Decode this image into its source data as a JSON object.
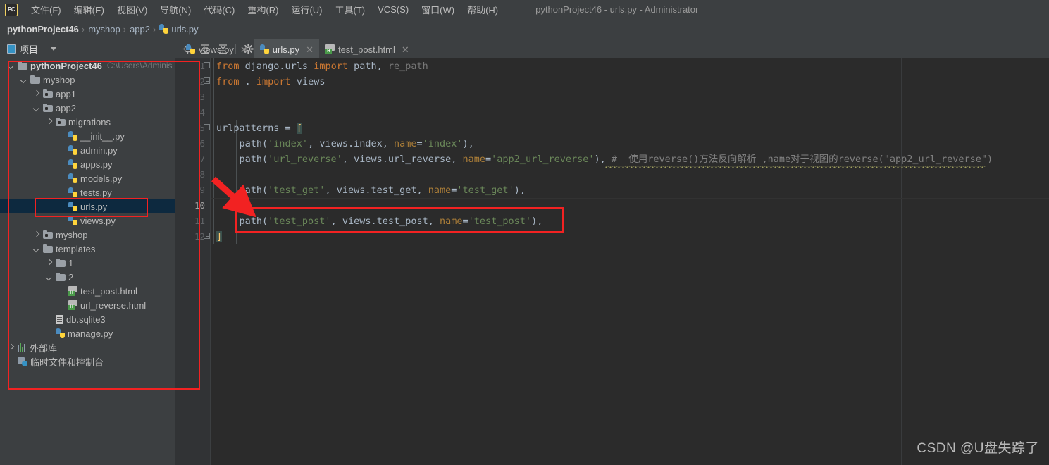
{
  "window": {
    "title": "pythonProject46 - urls.py - Administrator",
    "logo_text": "PC"
  },
  "menubar": {
    "items": [
      {
        "label": "文件(F)",
        "name": "menu-file"
      },
      {
        "label": "编辑(E)",
        "name": "menu-edit"
      },
      {
        "label": "视图(V)",
        "name": "menu-view"
      },
      {
        "label": "导航(N)",
        "name": "menu-navigate"
      },
      {
        "label": "代码(C)",
        "name": "menu-code"
      },
      {
        "label": "重构(R)",
        "name": "menu-refactor"
      },
      {
        "label": "运行(U)",
        "name": "menu-run"
      },
      {
        "label": "工具(T)",
        "name": "menu-tools"
      },
      {
        "label": "VCS(S)",
        "name": "menu-vcs"
      },
      {
        "label": "窗口(W)",
        "name": "menu-window"
      },
      {
        "label": "帮助(H)",
        "name": "menu-help"
      }
    ]
  },
  "breadcrumb": {
    "items": [
      "pythonProject46",
      "myshop",
      "app2",
      "urls.py"
    ],
    "separator": "›"
  },
  "toolwindow": {
    "title": "项目",
    "buttons": [
      {
        "name": "select-opened-file-icon",
        "title": "locate"
      },
      {
        "name": "expand-all-icon",
        "title": "expand all"
      },
      {
        "name": "collapse-all-icon",
        "title": "collapse all"
      },
      {
        "name": "settings-gear-icon",
        "title": "settings"
      },
      {
        "name": "hide-icon",
        "title": "hide"
      }
    ]
  },
  "editor_tabs": [
    {
      "label": "views.py",
      "icon": "python-file-icon",
      "active": false
    },
    {
      "label": "urls.py",
      "icon": "python-file-icon",
      "active": true
    },
    {
      "label": "test_post.html",
      "icon": "html-file-icon",
      "active": false
    }
  ],
  "project_tree": [
    {
      "label": "pythonProject46",
      "suffix": "C:\\Users\\Adminis",
      "depth": 0,
      "twist": "open",
      "icon": "folder-icon",
      "bold": true,
      "selected": false
    },
    {
      "label": "myshop",
      "suffix": "",
      "depth": 1,
      "twist": "open",
      "icon": "folder-icon",
      "bold": false,
      "selected": false
    },
    {
      "label": "app1",
      "suffix": "",
      "depth": 2,
      "twist": "closed",
      "icon": "module-folder-icon",
      "bold": false,
      "selected": false
    },
    {
      "label": "app2",
      "suffix": "",
      "depth": 2,
      "twist": "open",
      "icon": "module-folder-icon",
      "bold": false,
      "selected": false
    },
    {
      "label": "migrations",
      "suffix": "",
      "depth": 3,
      "twist": "closed",
      "icon": "module-folder-icon",
      "bold": false,
      "selected": false
    },
    {
      "label": "__init__.py",
      "suffix": "",
      "depth": 4,
      "twist": "none",
      "icon": "python-file-icon",
      "bold": false,
      "selected": false
    },
    {
      "label": "admin.py",
      "suffix": "",
      "depth": 4,
      "twist": "none",
      "icon": "python-file-icon",
      "bold": false,
      "selected": false
    },
    {
      "label": "apps.py",
      "suffix": "",
      "depth": 4,
      "twist": "none",
      "icon": "python-file-icon",
      "bold": false,
      "selected": false
    },
    {
      "label": "models.py",
      "suffix": "",
      "depth": 4,
      "twist": "none",
      "icon": "python-file-icon",
      "bold": false,
      "selected": false
    },
    {
      "label": "tests.py",
      "suffix": "",
      "depth": 4,
      "twist": "none",
      "icon": "python-file-icon",
      "bold": false,
      "selected": false
    },
    {
      "label": "urls.py",
      "suffix": "",
      "depth": 4,
      "twist": "none",
      "icon": "python-file-icon",
      "bold": false,
      "selected": true
    },
    {
      "label": "views.py",
      "suffix": "",
      "depth": 4,
      "twist": "none",
      "icon": "python-file-icon",
      "bold": false,
      "selected": false
    },
    {
      "label": "myshop",
      "suffix": "",
      "depth": 2,
      "twist": "closed",
      "icon": "module-folder-icon",
      "bold": false,
      "selected": false
    },
    {
      "label": "templates",
      "suffix": "",
      "depth": 2,
      "twist": "open",
      "icon": "folder-icon",
      "bold": false,
      "selected": false
    },
    {
      "label": "1",
      "suffix": "",
      "depth": 3,
      "twist": "closed",
      "icon": "folder-icon",
      "bold": false,
      "selected": false
    },
    {
      "label": "2",
      "suffix": "",
      "depth": 3,
      "twist": "open",
      "icon": "folder-icon",
      "bold": false,
      "selected": false
    },
    {
      "label": "test_post.html",
      "suffix": "",
      "depth": 4,
      "twist": "none",
      "icon": "html-file-icon",
      "bold": false,
      "selected": false
    },
    {
      "label": "url_reverse.html",
      "suffix": "",
      "depth": 4,
      "twist": "none",
      "icon": "html-file-icon",
      "bold": false,
      "selected": false
    },
    {
      "label": "db.sqlite3",
      "suffix": "",
      "depth": 3,
      "twist": "none",
      "icon": "db-file-icon",
      "bold": false,
      "selected": false
    },
    {
      "label": "manage.py",
      "suffix": "",
      "depth": 3,
      "twist": "none",
      "icon": "python-file-icon",
      "bold": false,
      "selected": false
    },
    {
      "label": "外部库",
      "suffix": "",
      "depth": 0,
      "twist": "closed",
      "icon": "external-libraries-icon",
      "bold": false,
      "selected": false
    },
    {
      "label": "临时文件和控制台",
      "suffix": "",
      "depth": 0,
      "twist": "none",
      "icon": "scratches-console-icon",
      "bold": false,
      "selected": false
    }
  ],
  "editor": {
    "line_numbers": [
      "1",
      "2",
      "3",
      "4",
      "5",
      "6",
      "7",
      "8",
      "9",
      "10",
      "11",
      "12"
    ],
    "current_line": 10,
    "lines": [
      {
        "n": 1,
        "tokens": [
          {
            "t": "from",
            "c": "k"
          },
          {
            "t": " django.urls ",
            "c": "id"
          },
          {
            "t": "import",
            "c": "k"
          },
          {
            "t": " path",
            "c": "id"
          },
          {
            "t": ",",
            "c": "id"
          },
          {
            "t": " re_path",
            "c": "gray"
          }
        ]
      },
      {
        "n": 2,
        "tokens": [
          {
            "t": "from",
            "c": "k"
          },
          {
            "t": " . ",
            "c": "id"
          },
          {
            "t": "import",
            "c": "k"
          },
          {
            "t": " views",
            "c": "id"
          }
        ]
      },
      {
        "n": 3,
        "tokens": []
      },
      {
        "n": 4,
        "tokens": []
      },
      {
        "n": 5,
        "tokens": [
          {
            "t": "urlpatterns ",
            "c": "id"
          },
          {
            "t": "= ",
            "c": "id"
          },
          {
            "t": "[",
            "c": "match"
          }
        ]
      },
      {
        "n": 6,
        "tokens": [
          {
            "t": "    path(",
            "c": "id"
          },
          {
            "t": "'index'",
            "c": "str"
          },
          {
            "t": ", views.index, ",
            "c": "id"
          },
          {
            "t": "name",
            "c": "kw"
          },
          {
            "t": "=",
            "c": "id"
          },
          {
            "t": "'index'",
            "c": "str"
          },
          {
            "t": "),",
            "c": "id"
          }
        ]
      },
      {
        "n": 7,
        "tokens": [
          {
            "t": "    path(",
            "c": "id"
          },
          {
            "t": "'url_reverse'",
            "c": "str"
          },
          {
            "t": ", views.url_reverse, ",
            "c": "id"
          },
          {
            "t": "name",
            "c": "kw"
          },
          {
            "t": "=",
            "c": "id"
          },
          {
            "t": "'app2_url_reverse'",
            "c": "str"
          },
          {
            "t": "), ",
            "c": "id"
          },
          {
            "t": "#  使用reverse()方法反向解析 ,name对于视图的reverse(\"app2_url_reverse\")",
            "c": "cmt"
          }
        ]
      },
      {
        "n": 8,
        "tokens": []
      },
      {
        "n": 9,
        "tokens": [
          {
            "t": "    path(",
            "c": "id"
          },
          {
            "t": "'test_get'",
            "c": "str"
          },
          {
            "t": ", views.test_get, ",
            "c": "id"
          },
          {
            "t": "name",
            "c": "kw"
          },
          {
            "t": "=",
            "c": "id"
          },
          {
            "t": "'test_get'",
            "c": "str"
          },
          {
            "t": "),",
            "c": "id"
          }
        ]
      },
      {
        "n": 10,
        "tokens": []
      },
      {
        "n": 11,
        "tokens": [
          {
            "t": "    path(",
            "c": "id"
          },
          {
            "t": "'test_post'",
            "c": "str"
          },
          {
            "t": ", views.test_post, ",
            "c": "id"
          },
          {
            "t": "name",
            "c": "kw"
          },
          {
            "t": "=",
            "c": "id"
          },
          {
            "t": "'test_post'",
            "c": "str"
          },
          {
            "t": "),",
            "c": "id"
          }
        ]
      },
      {
        "n": 12,
        "tokens": [
          {
            "t": "]",
            "c": "match"
          }
        ]
      }
    ]
  },
  "annotations": {
    "highlight_color": "#f22222",
    "boxes": [
      {
        "name": "tree-panel-outline"
      },
      {
        "name": "urls-py-file-highlight"
      },
      {
        "name": "test-post-path-highlight"
      }
    ],
    "arrow": {
      "name": "red-arrow-pointer"
    }
  },
  "watermark": {
    "text": "CSDN @U盘失踪了"
  },
  "colors": {
    "panel_bg": "#3c3f41",
    "editor_bg": "#2b2b2b",
    "gutter_bg": "#313335",
    "accent": "#4a88c7",
    "selection": "#0d293f",
    "keyword": "#cc7832",
    "string": "#6a8759",
    "named_arg": "#aa7d38",
    "comment": "#808080",
    "default_text": "#a9b7c6"
  }
}
